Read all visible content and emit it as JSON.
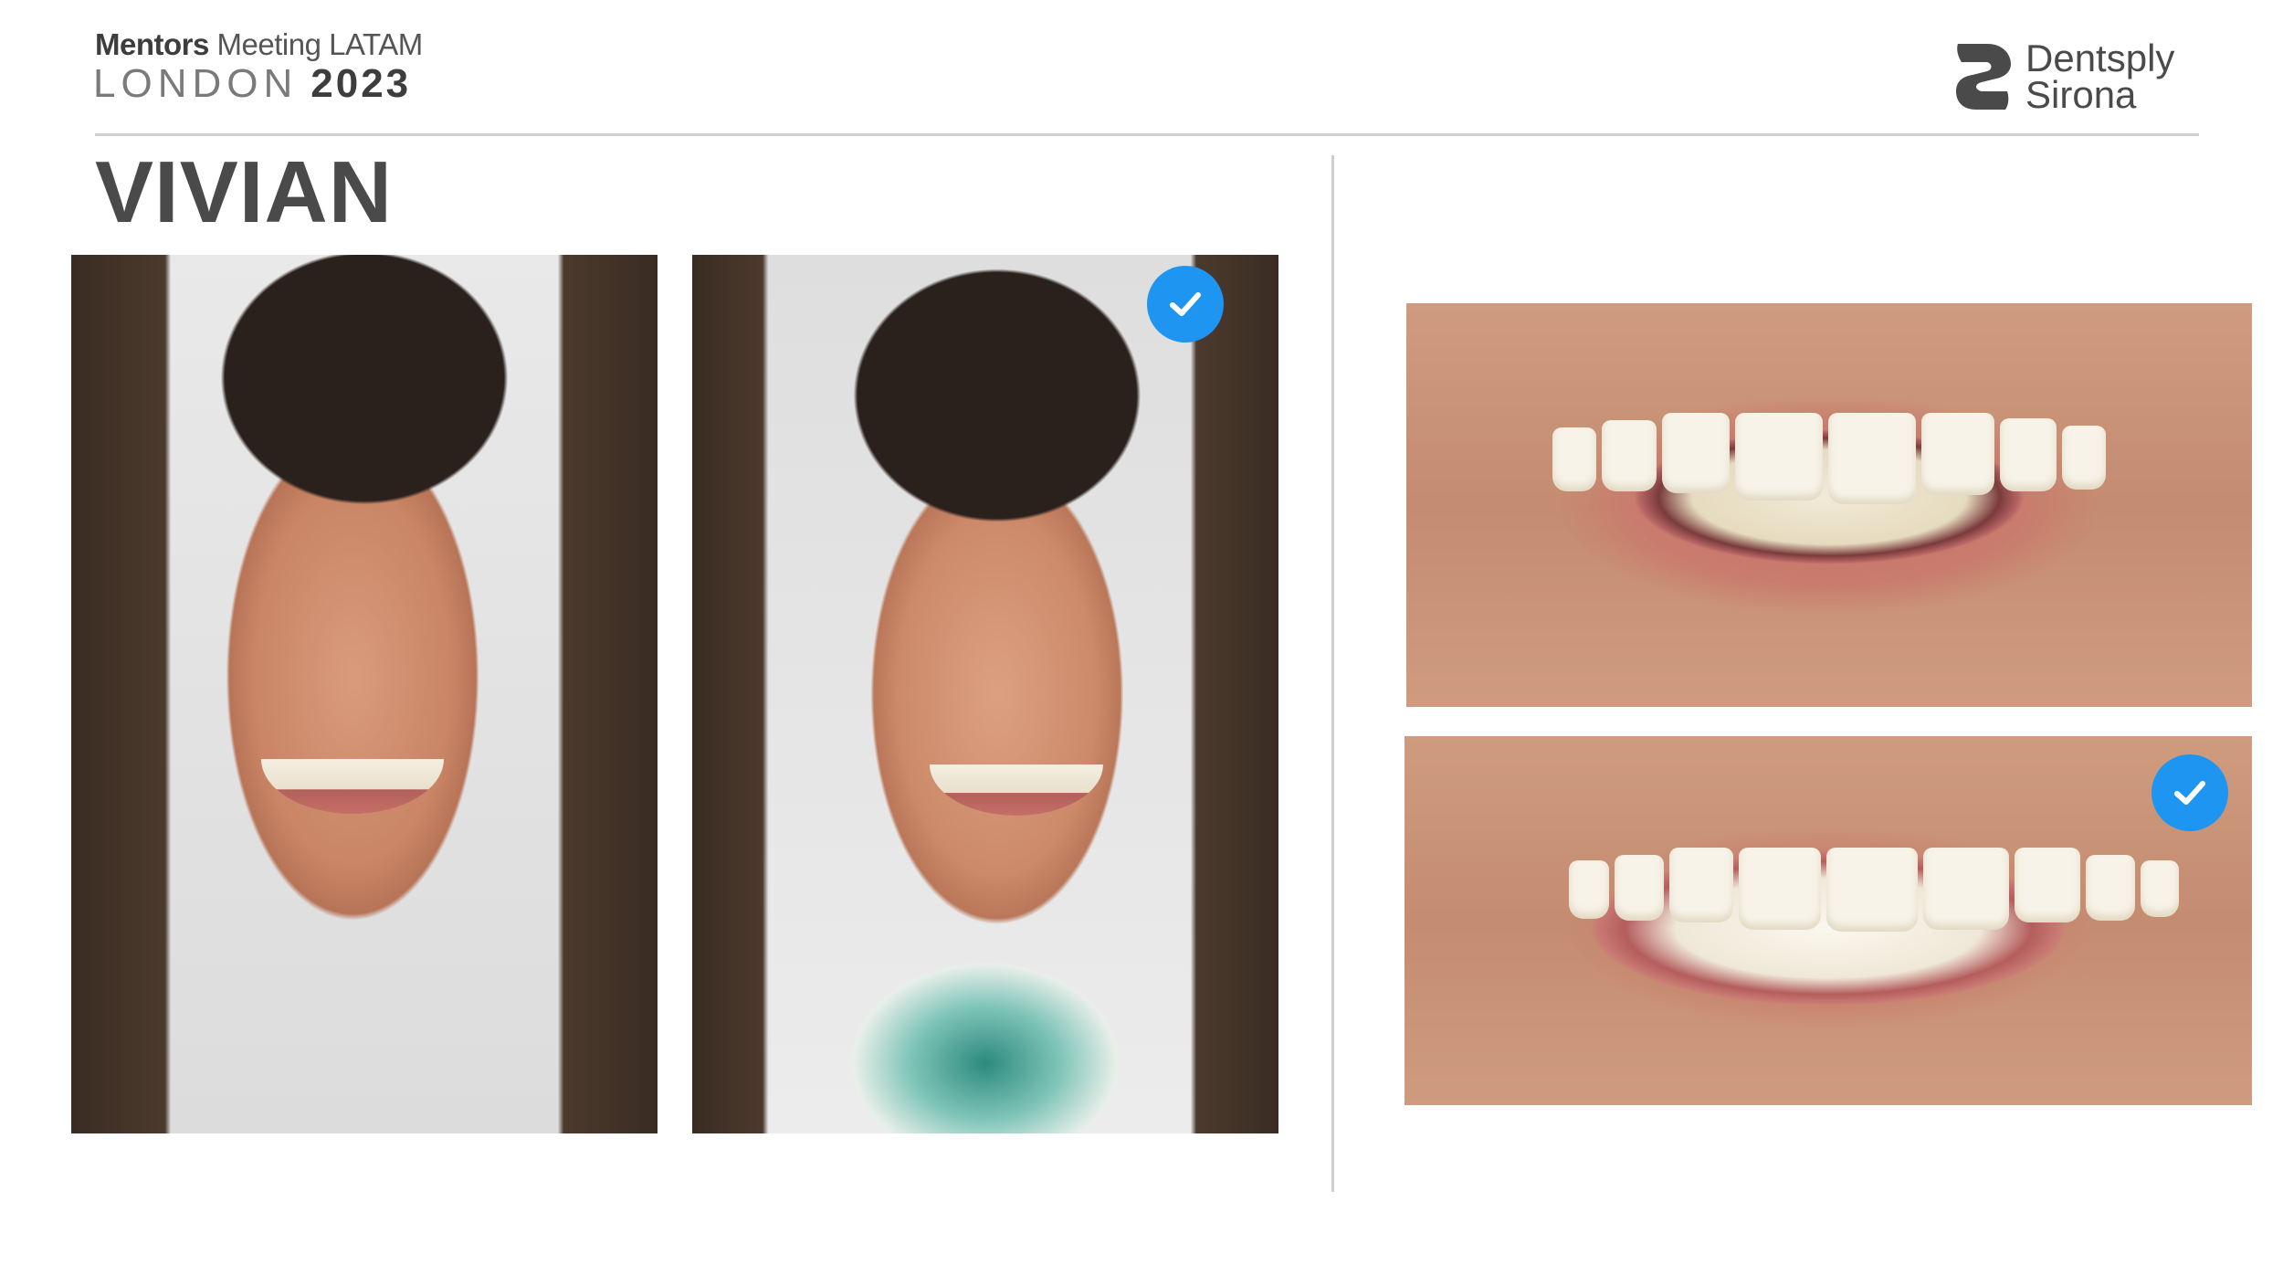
{
  "header": {
    "event_bold": "Mentors",
    "event_light": "Meeting LATAM",
    "city": "LONDON",
    "year": "2023"
  },
  "brand": {
    "name_line1": "Dentsply",
    "name_line2": "Sirona",
    "logo_icon": "dentsply-sirona-s-icon"
  },
  "patient": {
    "name": "VIVIAN"
  },
  "photos": {
    "face_before": {
      "icon": "face-photo-before"
    },
    "face_after": {
      "icon": "face-photo-after",
      "approved": true
    },
    "smile_before": {
      "icon": "smile-photo-before"
    },
    "smile_after": {
      "icon": "smile-photo-after",
      "approved": true
    }
  },
  "colors": {
    "check_badge": "#1f95f2",
    "rule": "#cfcfcf",
    "text_dark": "#4a4a4a"
  }
}
